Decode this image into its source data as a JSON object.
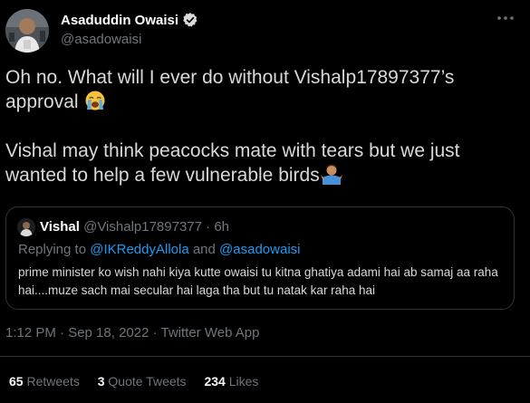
{
  "tweet": {
    "author": {
      "name": "Asaduddin Owaisi",
      "handle": "@asadowaisi",
      "verified": true
    },
    "text_line1": "Oh no. What will I ever do without Vishalp17897377’s approval",
    "text_line2": "Vishal may think peacocks mate with tears but we just wanted to help a few vulnerable birds",
    "emoji1": "loudly-crying-face",
    "emoji2": "man-shrugging",
    "timestamp": "1:12 PM · Sep 18, 2022 · ",
    "source": "Twitter Web App",
    "stats": {
      "retweets_count": "65",
      "retweets_label": "Retweets",
      "quotes_count": "3",
      "quotes_label": "Quote Tweets",
      "likes_count": "234",
      "likes_label": "Likes"
    }
  },
  "quote": {
    "name": "Vishal",
    "handle": "@Vishalp17897377",
    "separator": "·",
    "time": "6h",
    "reply_prefix": "Replying to ",
    "reply_user1": "@IKReddyAllola",
    "reply_and": " and ",
    "reply_user2": "@asadowaisi",
    "text": "prime minister ko wish nahi kiya kutte owaisi  tu kitna ghatiya adami hai ab samaj aa raha hai....muze sach mai secular hai laga tha but tu natak kar raha hai"
  },
  "colors": {
    "background": "#000000",
    "text": "#d9d9d9",
    "muted": "#6e767d",
    "link": "#1d9bf0",
    "border": "#2f3336"
  }
}
